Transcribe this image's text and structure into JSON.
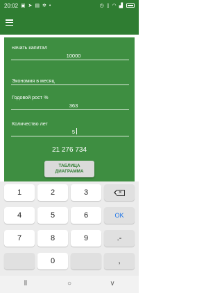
{
  "status_bar": {
    "time": "20:02",
    "left_icons": [
      "notification-icon",
      "send-icon",
      "sim-icon",
      "settings-icon",
      "dot-icon"
    ],
    "right_icons": [
      "alarm-icon",
      "vibrate-icon",
      "wifi-icon",
      "signal-icon",
      "battery-icon"
    ]
  },
  "app_bar": {
    "menu_icon": "hamburger-menu-icon"
  },
  "form": {
    "capital_label": "начать капитал",
    "capital_value": "10000",
    "savings_label": "Экономия в месяц",
    "savings_value": "",
    "growth_label": "Годовой рост %",
    "growth_value": "363",
    "years_label": "Количество лет",
    "years_value": "5"
  },
  "result": "21 276 734",
  "action_button": {
    "line1": "ТАБЛИЦА",
    "line2": "ДИАГРАММА"
  },
  "keyboard": {
    "keys": [
      "1",
      "2",
      "3",
      "4",
      "5",
      "6",
      "7",
      "8",
      "9",
      "0",
      ",",
      ".-",
      "OK"
    ],
    "backspace_icon": "backspace-icon"
  },
  "nav": {
    "icons": [
      "recent-apps-icon",
      "home-icon",
      "back-icon"
    ]
  },
  "colors": {
    "primary": "#2f7d32",
    "panel": "#3e8e41",
    "accent": "#1a73e8"
  }
}
